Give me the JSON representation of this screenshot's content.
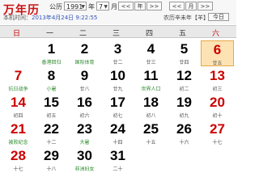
{
  "header": {
    "title": "万年历",
    "era": "公历",
    "year_value": "1991",
    "year_label": "年",
    "month_value": "7",
    "month_label": "月",
    "nav_buttons": [
      "<<",
      "年",
      ">>",
      "<<",
      "月",
      ">>"
    ],
    "today_button": "今日",
    "local_time_label": "本机时间：",
    "local_time_value": "2013年4月24日 9:22:55",
    "lunar_info": "农历辛未年【羊】"
  },
  "weekdays": [
    "日",
    "一",
    "二",
    "三",
    "四",
    "五",
    "六"
  ],
  "days": [
    {
      "date": "1",
      "sub": "香港回归",
      "red": false,
      "festival": true
    },
    {
      "date": "2",
      "sub": "国际体育",
      "red": false,
      "festival": true
    },
    {
      "date": "3",
      "sub": "廿二",
      "red": false,
      "festival": false
    },
    {
      "date": "4",
      "sub": "廿三",
      "red": false,
      "festival": false
    },
    {
      "date": "5",
      "sub": "廿四",
      "red": false,
      "festival": false
    },
    {
      "date": "6",
      "sub": "廿五",
      "red": true,
      "festival": false,
      "today": true
    },
    {
      "date": "7",
      "sub": "抗日战争",
      "red": true,
      "festival": true
    },
    {
      "date": "8",
      "sub": "小暑",
      "red": false,
      "festival": true
    },
    {
      "date": "9",
      "sub": "廿八",
      "red": false,
      "festival": false
    },
    {
      "date": "10",
      "sub": "廿九",
      "red": false,
      "festival": false
    },
    {
      "date": "11",
      "sub": "世界人口",
      "red": false,
      "festival": true
    },
    {
      "date": "12",
      "sub": "初二",
      "red": false,
      "festival": false
    },
    {
      "date": "13",
      "sub": "初三",
      "red": true,
      "festival": false
    },
    {
      "date": "14",
      "sub": "初四",
      "red": true,
      "festival": false
    },
    {
      "date": "15",
      "sub": "初五",
      "red": false,
      "festival": false
    },
    {
      "date": "16",
      "sub": "初六",
      "red": false,
      "festival": false
    },
    {
      "date": "17",
      "sub": "初七",
      "red": false,
      "festival": false
    },
    {
      "date": "18",
      "sub": "初八",
      "red": false,
      "festival": false
    },
    {
      "date": "19",
      "sub": "初九",
      "red": false,
      "festival": false
    },
    {
      "date": "20",
      "sub": "初十",
      "red": true,
      "festival": false
    },
    {
      "date": "21",
      "sub": "被败纪念",
      "red": true,
      "festival": true
    },
    {
      "date": "22",
      "sub": "十二",
      "red": false,
      "festival": false
    },
    {
      "date": "23",
      "sub": "大暑",
      "red": false,
      "festival": true
    },
    {
      "date": "24",
      "sub": "十四",
      "red": false,
      "festival": false
    },
    {
      "date": "25",
      "sub": "十五",
      "red": false,
      "festival": false
    },
    {
      "date": "26",
      "sub": "十六",
      "red": false,
      "festival": false
    },
    {
      "date": "27",
      "sub": "十七",
      "red": true,
      "festival": false
    },
    {
      "date": "28",
      "sub": "十七",
      "red": true,
      "festival": false
    },
    {
      "date": "29",
      "sub": "十八",
      "red": false,
      "festival": false
    },
    {
      "date": "30",
      "sub": "非洲妇女",
      "red": false,
      "festival": true
    },
    {
      "date": "31",
      "sub": "二十",
      "red": false,
      "festival": false
    }
  ]
}
